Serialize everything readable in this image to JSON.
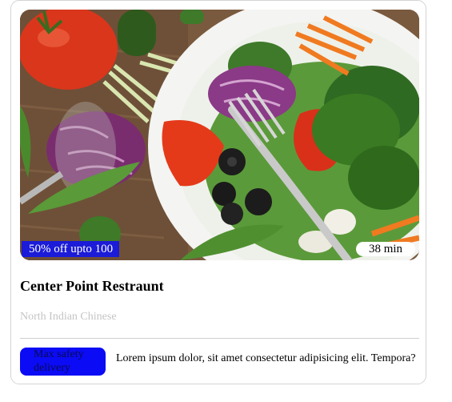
{
  "card": {
    "image_alt": "salad",
    "offer": "50% off upto 100",
    "delivery_time": "38 min",
    "name": "Center Point Restraunt",
    "cuisine": "North Indian Chinese",
    "safety_badge": "Max safety delivery",
    "description": "Lorem ipsum dolor, sit amet consectetur adipisicing elit. Tempora?"
  },
  "colors": {
    "offer_badge": "#1b1bd8",
    "safety_badge": "#0b0bf5",
    "cuisine_text": "#c4c4c4",
    "divider": "#cfcfcf"
  }
}
